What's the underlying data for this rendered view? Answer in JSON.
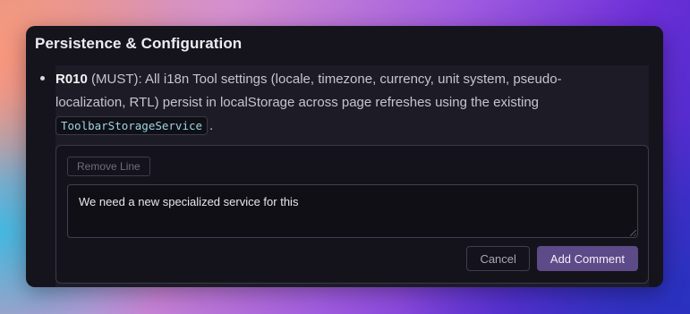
{
  "section": {
    "title": "Persistence & Configuration"
  },
  "requirement": {
    "id": "R010",
    "level": "(MUST)",
    "text_before_code": ": All i18n Tool settings (locale, timezone, currency, unit system, pseudo-localization, RTL) persist in localStorage across page refreshes using the existing",
    "code": "ToolbarStorageService",
    "text_after_code": "."
  },
  "comment_form": {
    "remove_line_label": "Remove Line",
    "comment_value": "We need a new specialized service for this",
    "cancel_label": "Cancel",
    "submit_label": "Add Comment"
  },
  "colors": {
    "panel_bg": "#15141d",
    "item_bg": "#1d1c26",
    "primary_button": "#5d4a88",
    "code_text": "#9fd3e6"
  }
}
